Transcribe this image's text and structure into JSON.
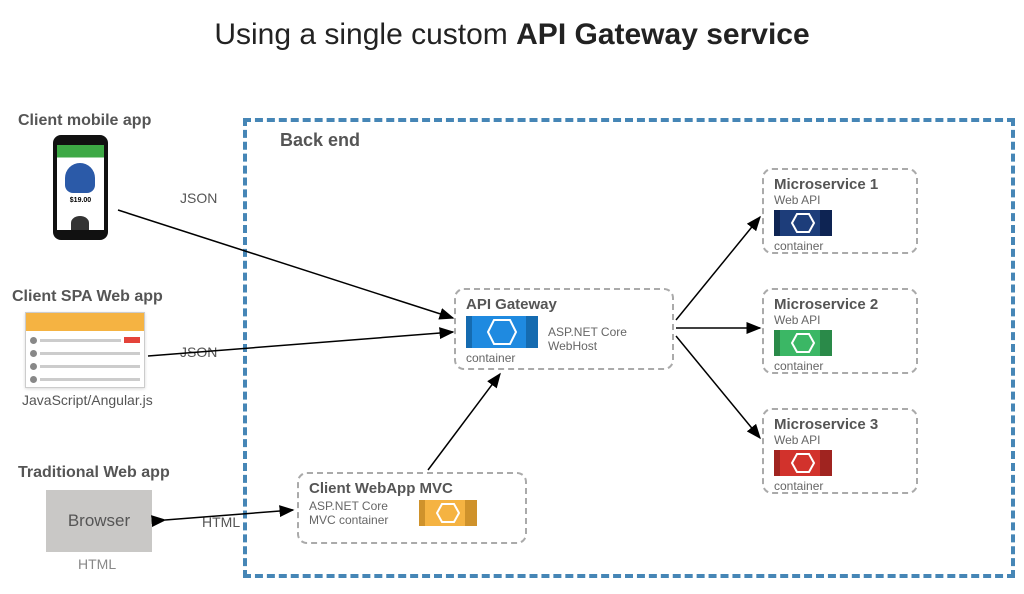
{
  "title_prefix": "Using a single custom ",
  "title_bold": "API Gateway service",
  "backend_label": "Back end",
  "clients": {
    "mobile": {
      "label": "Client mobile app",
      "wire_label": "JSON",
      "price": "$19.00"
    },
    "spa": {
      "label": "Client SPA Web app",
      "wire_label": "JSON",
      "caption": "JavaScript/Angular.js"
    },
    "traditional": {
      "label": "Traditional Web app",
      "browser_text": "Browser",
      "wire_label": "HTML",
      "caption": "HTML"
    }
  },
  "gateway": {
    "title": "API Gateway",
    "host": "ASP.NET Core WebHost",
    "container_label": "container"
  },
  "webapp_mvc": {
    "title": "Client WebApp MVC",
    "sub": "ASP.NET Core MVC container"
  },
  "microservices": [
    {
      "title": "Microservice 1",
      "api_label": "Web API",
      "container_label": "container",
      "color": "#1d3d7a",
      "end": "#0e2453"
    },
    {
      "title": "Microservice 2",
      "api_label": "Web API",
      "container_label": "container",
      "color": "#3bb765",
      "end": "#2a8a49"
    },
    {
      "title": "Microservice 3",
      "api_label": "Web API",
      "container_label": "container",
      "color": "#d2322c",
      "end": "#a02420"
    }
  ],
  "colors": {
    "gateway": {
      "body": "#1f8ae0",
      "end": "#156bb0"
    },
    "mvc": {
      "body": "#f5b342",
      "end": "#cf922b"
    }
  }
}
